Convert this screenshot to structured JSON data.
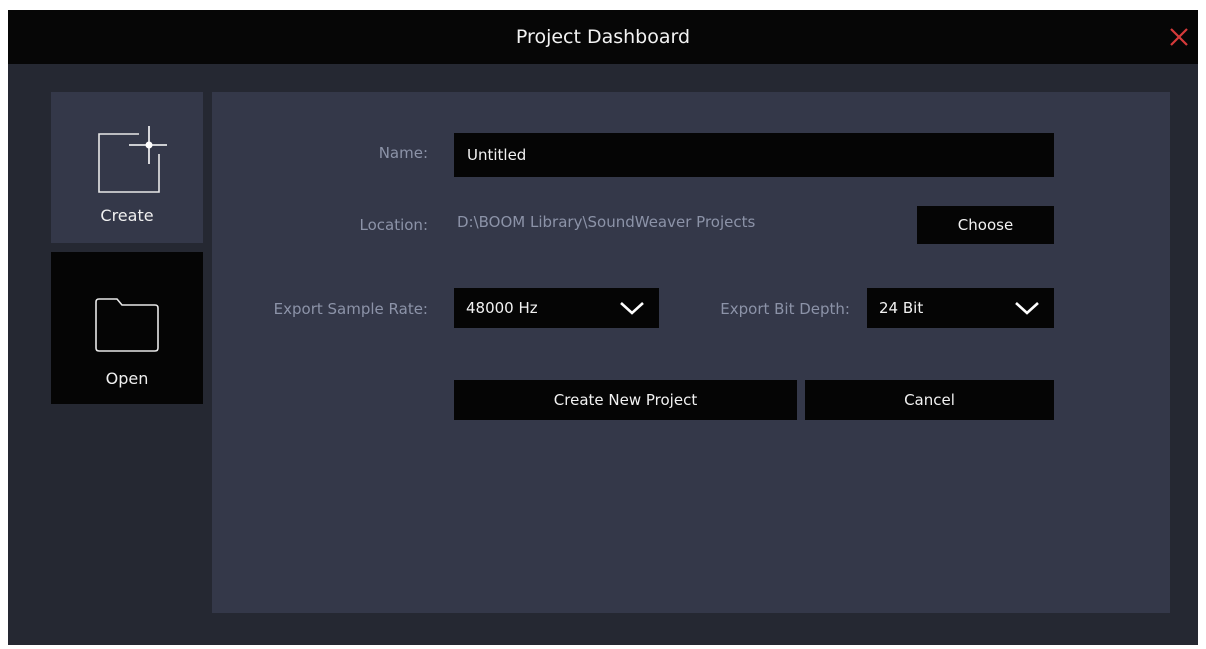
{
  "window": {
    "title": "Project Dashboard",
    "close_icon": "close-icon",
    "close_color": "#d63a3a"
  },
  "sidebar": {
    "tabs": [
      {
        "label": "Create",
        "icon": "new-project-icon",
        "active": true
      },
      {
        "label": "Open",
        "icon": "folder-icon",
        "active": false
      }
    ]
  },
  "form": {
    "name": {
      "label": "Name:",
      "value": "Untitled"
    },
    "location": {
      "label": "Location:",
      "value": "D:\\BOOM Library\\SoundWeaver Projects",
      "button_label": "Choose"
    },
    "sample_rate": {
      "label": "Export Sample Rate:",
      "value": "48000 Hz"
    },
    "bit_depth": {
      "label": "Export Bit Depth:",
      "value": "24 Bit"
    },
    "create_button": "Create New Project",
    "cancel_button": "Cancel"
  },
  "colors": {
    "titlebar": "#060606",
    "window_bg": "#252832",
    "panel_bg": "#343849",
    "label_text": "#8c93a8",
    "control_bg": "#050505"
  }
}
